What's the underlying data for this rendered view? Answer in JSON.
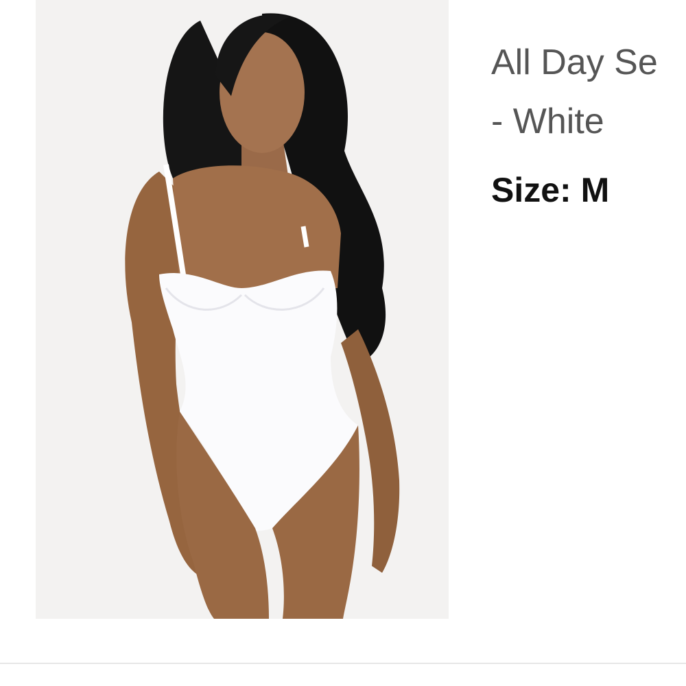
{
  "product": {
    "title_line1": "All Day Se",
    "title_line2": "- White",
    "size_label": "Size:",
    "size_value": "M",
    "image_icon": "product-photo"
  },
  "colors": {
    "title_text": "#555555",
    "size_text": "#111111",
    "image_background": "#f3f2f1",
    "divider": "#e6e6e6"
  }
}
